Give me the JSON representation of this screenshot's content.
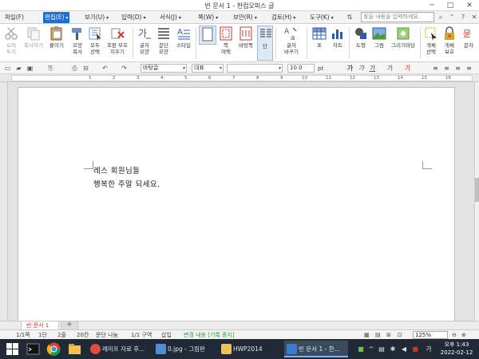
{
  "window": {
    "title": "빈 문서 1 - 한컴오피스 글",
    "minimize": "─",
    "maximize": "□",
    "close": "✕"
  },
  "menu": {
    "items": [
      "파일(F)",
      "편집(E)",
      "보기(U)",
      "입력(D)",
      "서식(J)",
      "쪽(W)",
      "보안(R)",
      "검토(H)",
      "도구(K)"
    ],
    "active_index": 1,
    "search_placeholder": "찾을 내용을 입력하세요."
  },
  "ribbon": {
    "cut": "오려\n두기",
    "copy": "복사하기",
    "paste": "붙이기",
    "format_copy": "모양\n복사",
    "select_all": "모두\n선택",
    "remove_protect": "조판 부호\n지우기",
    "char_shape": "글자\n모양",
    "para_shape": "문단\n모양",
    "style": "스타일",
    "page_margin": "쪽\n여백",
    "page_bg": "바탕쪽",
    "column": "단",
    "char_convert": "글자\n바꾸기",
    "table": "표",
    "chart": "차트",
    "shape": "도형",
    "picture": "그림",
    "drawing": "그리기마당",
    "object_select": "개체\n선택",
    "object_protect": "개체\n보호",
    "ruler_more": "문자"
  },
  "toolbar": {
    "style_combo": "바탕글",
    "lang_combo": "대표",
    "font_combo": "",
    "size_combo": "10.0",
    "unit": "pt",
    "bold": "가",
    "italic": "가",
    "underline": "가",
    "color_a": "가",
    "color_b": "가"
  },
  "ruler": {
    "numbers": [
      "1",
      "2",
      "3",
      "4",
      "5",
      "6",
      "7",
      "8",
      "9",
      "10",
      "11",
      "12",
      "13",
      "14",
      "15",
      "16"
    ]
  },
  "document": {
    "lines": [
      "레스 회원님들",
      "행복한 주말 되세요."
    ]
  },
  "tabs": {
    "doc_tab": "빈 문서 1",
    "add_tab": "+"
  },
  "status": {
    "page": "1/1쪽",
    "section": "1단",
    "line": "2줄",
    "col": "20칸",
    "char_break": "문단 나눔",
    "area": "1/1 구역",
    "insert": "삽입",
    "track": "변경 내용 [기록 중지]",
    "zoom": "125%"
  },
  "taskbar": {
    "apps": [
      {
        "label": "레미프 자료 후...",
        "color": "#e34b3a"
      },
      {
        "label": "0.jpg - 그림판",
        "color": "#4a90d9"
      },
      {
        "label": "HWP2014",
        "color": "#f2c14e"
      },
      {
        "label": "빈 문서 1 - 한...",
        "color": "#3a7bd5"
      }
    ],
    "time": "오후 1:43",
    "date": "2022-02-12"
  }
}
